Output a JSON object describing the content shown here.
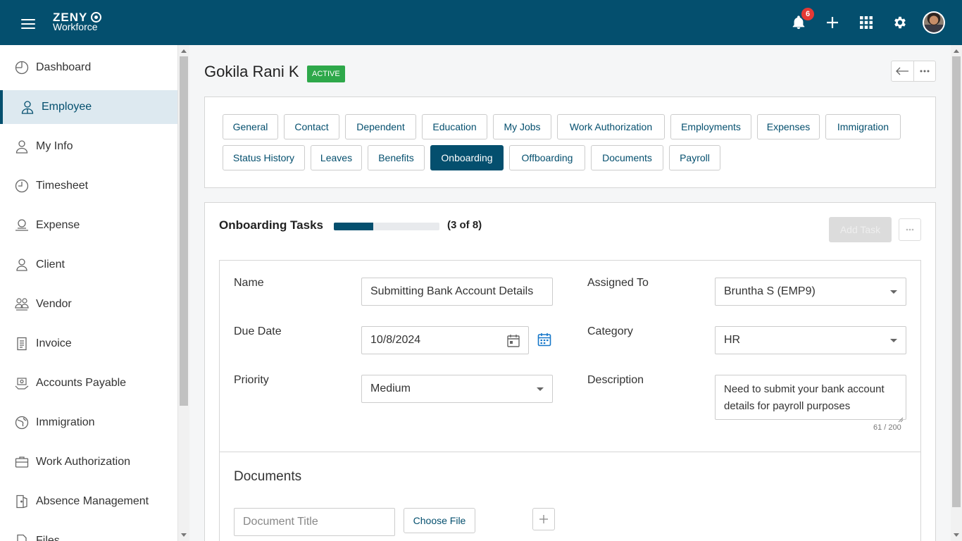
{
  "app": {
    "logo_top": "ZENY",
    "logo_bottom": "Workforce",
    "notifications_count": "6",
    "icons": [
      "menu-icon",
      "bell-icon",
      "plus-icon",
      "apps-grid-icon",
      "gear-icon",
      "avatar"
    ]
  },
  "sidebar": {
    "items": [
      {
        "label": "Dashboard",
        "icon": "dashboard-icon"
      },
      {
        "label": "Employee",
        "icon": "employee-icon",
        "active": true
      },
      {
        "label": "My Info",
        "icon": "my-info-icon"
      },
      {
        "label": "Timesheet",
        "icon": "clock-icon"
      },
      {
        "label": "Expense",
        "icon": "expense-icon"
      },
      {
        "label": "Client",
        "icon": "client-icon"
      },
      {
        "label": "Vendor",
        "icon": "vendor-icon"
      },
      {
        "label": "Invoice",
        "icon": "invoice-icon"
      },
      {
        "label": "Accounts Payable",
        "icon": "accounts-payable-icon"
      },
      {
        "label": "Immigration",
        "icon": "globe-icon"
      },
      {
        "label": "Work Authorization",
        "icon": "briefcase-icon"
      },
      {
        "label": "Absence Management",
        "icon": "door-icon"
      },
      {
        "label": "Files",
        "icon": "file-icon"
      }
    ]
  },
  "employee": {
    "name": "Gokila Rani K",
    "status": "ACTIVE"
  },
  "tabs": {
    "row1": [
      "General",
      "Contact",
      "Dependent",
      "Education",
      "My Jobs",
      "Work Authorization",
      "Employments",
      "Expenses",
      "Immigration"
    ],
    "row2": [
      "Status History",
      "Leaves",
      "Benefits",
      "Onboarding",
      "Offboarding",
      "Documents",
      "Payroll"
    ],
    "active": "Onboarding"
  },
  "onboarding": {
    "title": "Onboarding Tasks",
    "progress_done": 3,
    "progress_total": 8,
    "progress_fraction": 0.375,
    "count_text": "(3 of 8)",
    "add_task_label": "Add Task"
  },
  "task": {
    "name_label": "Name",
    "name_value": "Submitting Bank Account Details",
    "assigned_label": "Assigned To",
    "assigned_value": "Bruntha S (EMP9)",
    "due_label": "Due Date",
    "due_value": "10/8/2024",
    "category_label": "Category",
    "category_value": "HR",
    "priority_label": "Priority",
    "priority_value": "Medium",
    "description_label": "Description",
    "description_value": "Need to submit your bank account details for payroll purposes",
    "description_counter": "61 / 200"
  },
  "documents": {
    "title": "Documents",
    "title_placeholder": "Document Title",
    "choose_file_label": "Choose File"
  },
  "colors": {
    "primary": "#044f6e",
    "status_active": "#2ea84a",
    "badge": "#e53935"
  }
}
